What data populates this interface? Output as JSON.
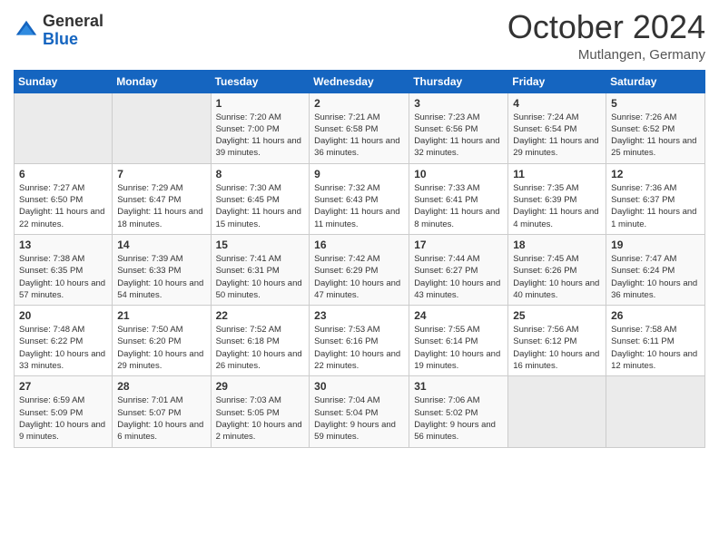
{
  "header": {
    "logo": {
      "general": "General",
      "blue": "Blue"
    },
    "title": "October 2024",
    "location": "Mutlangen, Germany"
  },
  "weekdays": [
    "Sunday",
    "Monday",
    "Tuesday",
    "Wednesday",
    "Thursday",
    "Friday",
    "Saturday"
  ],
  "weeks": [
    [
      {
        "day": "",
        "info": ""
      },
      {
        "day": "",
        "info": ""
      },
      {
        "day": "1",
        "info": "Sunrise: 7:20 AM\nSunset: 7:00 PM\nDaylight: 11 hours and 39 minutes."
      },
      {
        "day": "2",
        "info": "Sunrise: 7:21 AM\nSunset: 6:58 PM\nDaylight: 11 hours and 36 minutes."
      },
      {
        "day": "3",
        "info": "Sunrise: 7:23 AM\nSunset: 6:56 PM\nDaylight: 11 hours and 32 minutes."
      },
      {
        "day": "4",
        "info": "Sunrise: 7:24 AM\nSunset: 6:54 PM\nDaylight: 11 hours and 29 minutes."
      },
      {
        "day": "5",
        "info": "Sunrise: 7:26 AM\nSunset: 6:52 PM\nDaylight: 11 hours and 25 minutes."
      }
    ],
    [
      {
        "day": "6",
        "info": "Sunrise: 7:27 AM\nSunset: 6:50 PM\nDaylight: 11 hours and 22 minutes."
      },
      {
        "day": "7",
        "info": "Sunrise: 7:29 AM\nSunset: 6:47 PM\nDaylight: 11 hours and 18 minutes."
      },
      {
        "day": "8",
        "info": "Sunrise: 7:30 AM\nSunset: 6:45 PM\nDaylight: 11 hours and 15 minutes."
      },
      {
        "day": "9",
        "info": "Sunrise: 7:32 AM\nSunset: 6:43 PM\nDaylight: 11 hours and 11 minutes."
      },
      {
        "day": "10",
        "info": "Sunrise: 7:33 AM\nSunset: 6:41 PM\nDaylight: 11 hours and 8 minutes."
      },
      {
        "day": "11",
        "info": "Sunrise: 7:35 AM\nSunset: 6:39 PM\nDaylight: 11 hours and 4 minutes."
      },
      {
        "day": "12",
        "info": "Sunrise: 7:36 AM\nSunset: 6:37 PM\nDaylight: 11 hours and 1 minute."
      }
    ],
    [
      {
        "day": "13",
        "info": "Sunrise: 7:38 AM\nSunset: 6:35 PM\nDaylight: 10 hours and 57 minutes."
      },
      {
        "day": "14",
        "info": "Sunrise: 7:39 AM\nSunset: 6:33 PM\nDaylight: 10 hours and 54 minutes."
      },
      {
        "day": "15",
        "info": "Sunrise: 7:41 AM\nSunset: 6:31 PM\nDaylight: 10 hours and 50 minutes."
      },
      {
        "day": "16",
        "info": "Sunrise: 7:42 AM\nSunset: 6:29 PM\nDaylight: 10 hours and 47 minutes."
      },
      {
        "day": "17",
        "info": "Sunrise: 7:44 AM\nSunset: 6:27 PM\nDaylight: 10 hours and 43 minutes."
      },
      {
        "day": "18",
        "info": "Sunrise: 7:45 AM\nSunset: 6:26 PM\nDaylight: 10 hours and 40 minutes."
      },
      {
        "day": "19",
        "info": "Sunrise: 7:47 AM\nSunset: 6:24 PM\nDaylight: 10 hours and 36 minutes."
      }
    ],
    [
      {
        "day": "20",
        "info": "Sunrise: 7:48 AM\nSunset: 6:22 PM\nDaylight: 10 hours and 33 minutes."
      },
      {
        "day": "21",
        "info": "Sunrise: 7:50 AM\nSunset: 6:20 PM\nDaylight: 10 hours and 29 minutes."
      },
      {
        "day": "22",
        "info": "Sunrise: 7:52 AM\nSunset: 6:18 PM\nDaylight: 10 hours and 26 minutes."
      },
      {
        "day": "23",
        "info": "Sunrise: 7:53 AM\nSunset: 6:16 PM\nDaylight: 10 hours and 22 minutes."
      },
      {
        "day": "24",
        "info": "Sunrise: 7:55 AM\nSunset: 6:14 PM\nDaylight: 10 hours and 19 minutes."
      },
      {
        "day": "25",
        "info": "Sunrise: 7:56 AM\nSunset: 6:12 PM\nDaylight: 10 hours and 16 minutes."
      },
      {
        "day": "26",
        "info": "Sunrise: 7:58 AM\nSunset: 6:11 PM\nDaylight: 10 hours and 12 minutes."
      }
    ],
    [
      {
        "day": "27",
        "info": "Sunrise: 6:59 AM\nSunset: 5:09 PM\nDaylight: 10 hours and 9 minutes."
      },
      {
        "day": "28",
        "info": "Sunrise: 7:01 AM\nSunset: 5:07 PM\nDaylight: 10 hours and 6 minutes."
      },
      {
        "day": "29",
        "info": "Sunrise: 7:03 AM\nSunset: 5:05 PM\nDaylight: 10 hours and 2 minutes."
      },
      {
        "day": "30",
        "info": "Sunrise: 7:04 AM\nSunset: 5:04 PM\nDaylight: 9 hours and 59 minutes."
      },
      {
        "day": "31",
        "info": "Sunrise: 7:06 AM\nSunset: 5:02 PM\nDaylight: 9 hours and 56 minutes."
      },
      {
        "day": "",
        "info": ""
      },
      {
        "day": "",
        "info": ""
      }
    ]
  ]
}
